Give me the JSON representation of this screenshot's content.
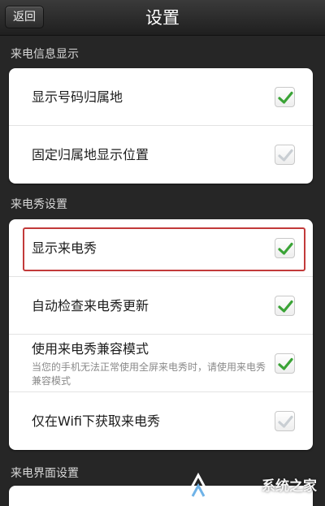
{
  "header": {
    "back_label": "返回",
    "title": "设置"
  },
  "sections": [
    {
      "label": "来电信息显示",
      "rows": [
        {
          "label": "显示号码归属地",
          "checked": true
        },
        {
          "label": "固定归属地显示位置",
          "checked": false
        }
      ]
    },
    {
      "label": "来电秀设置",
      "rows": [
        {
          "label": "显示来电秀",
          "checked": true
        },
        {
          "label": "自动检查来电秀更新",
          "checked": true
        },
        {
          "label": "使用来电秀兼容模式",
          "sublabel": "当您的手机无法正常使用全屏来电秀时，请使用来电秀兼容模式",
          "checked": true
        },
        {
          "label": "仅在Wifi下获取来电秀",
          "checked": false
        }
      ]
    },
    {
      "label": "来电界面设置",
      "rows": []
    }
  ],
  "watermark": "系统之家",
  "colors": {
    "check_green": "#3aa336",
    "check_disabled": "#c9ced3",
    "highlight_red": "#c23a3a"
  }
}
